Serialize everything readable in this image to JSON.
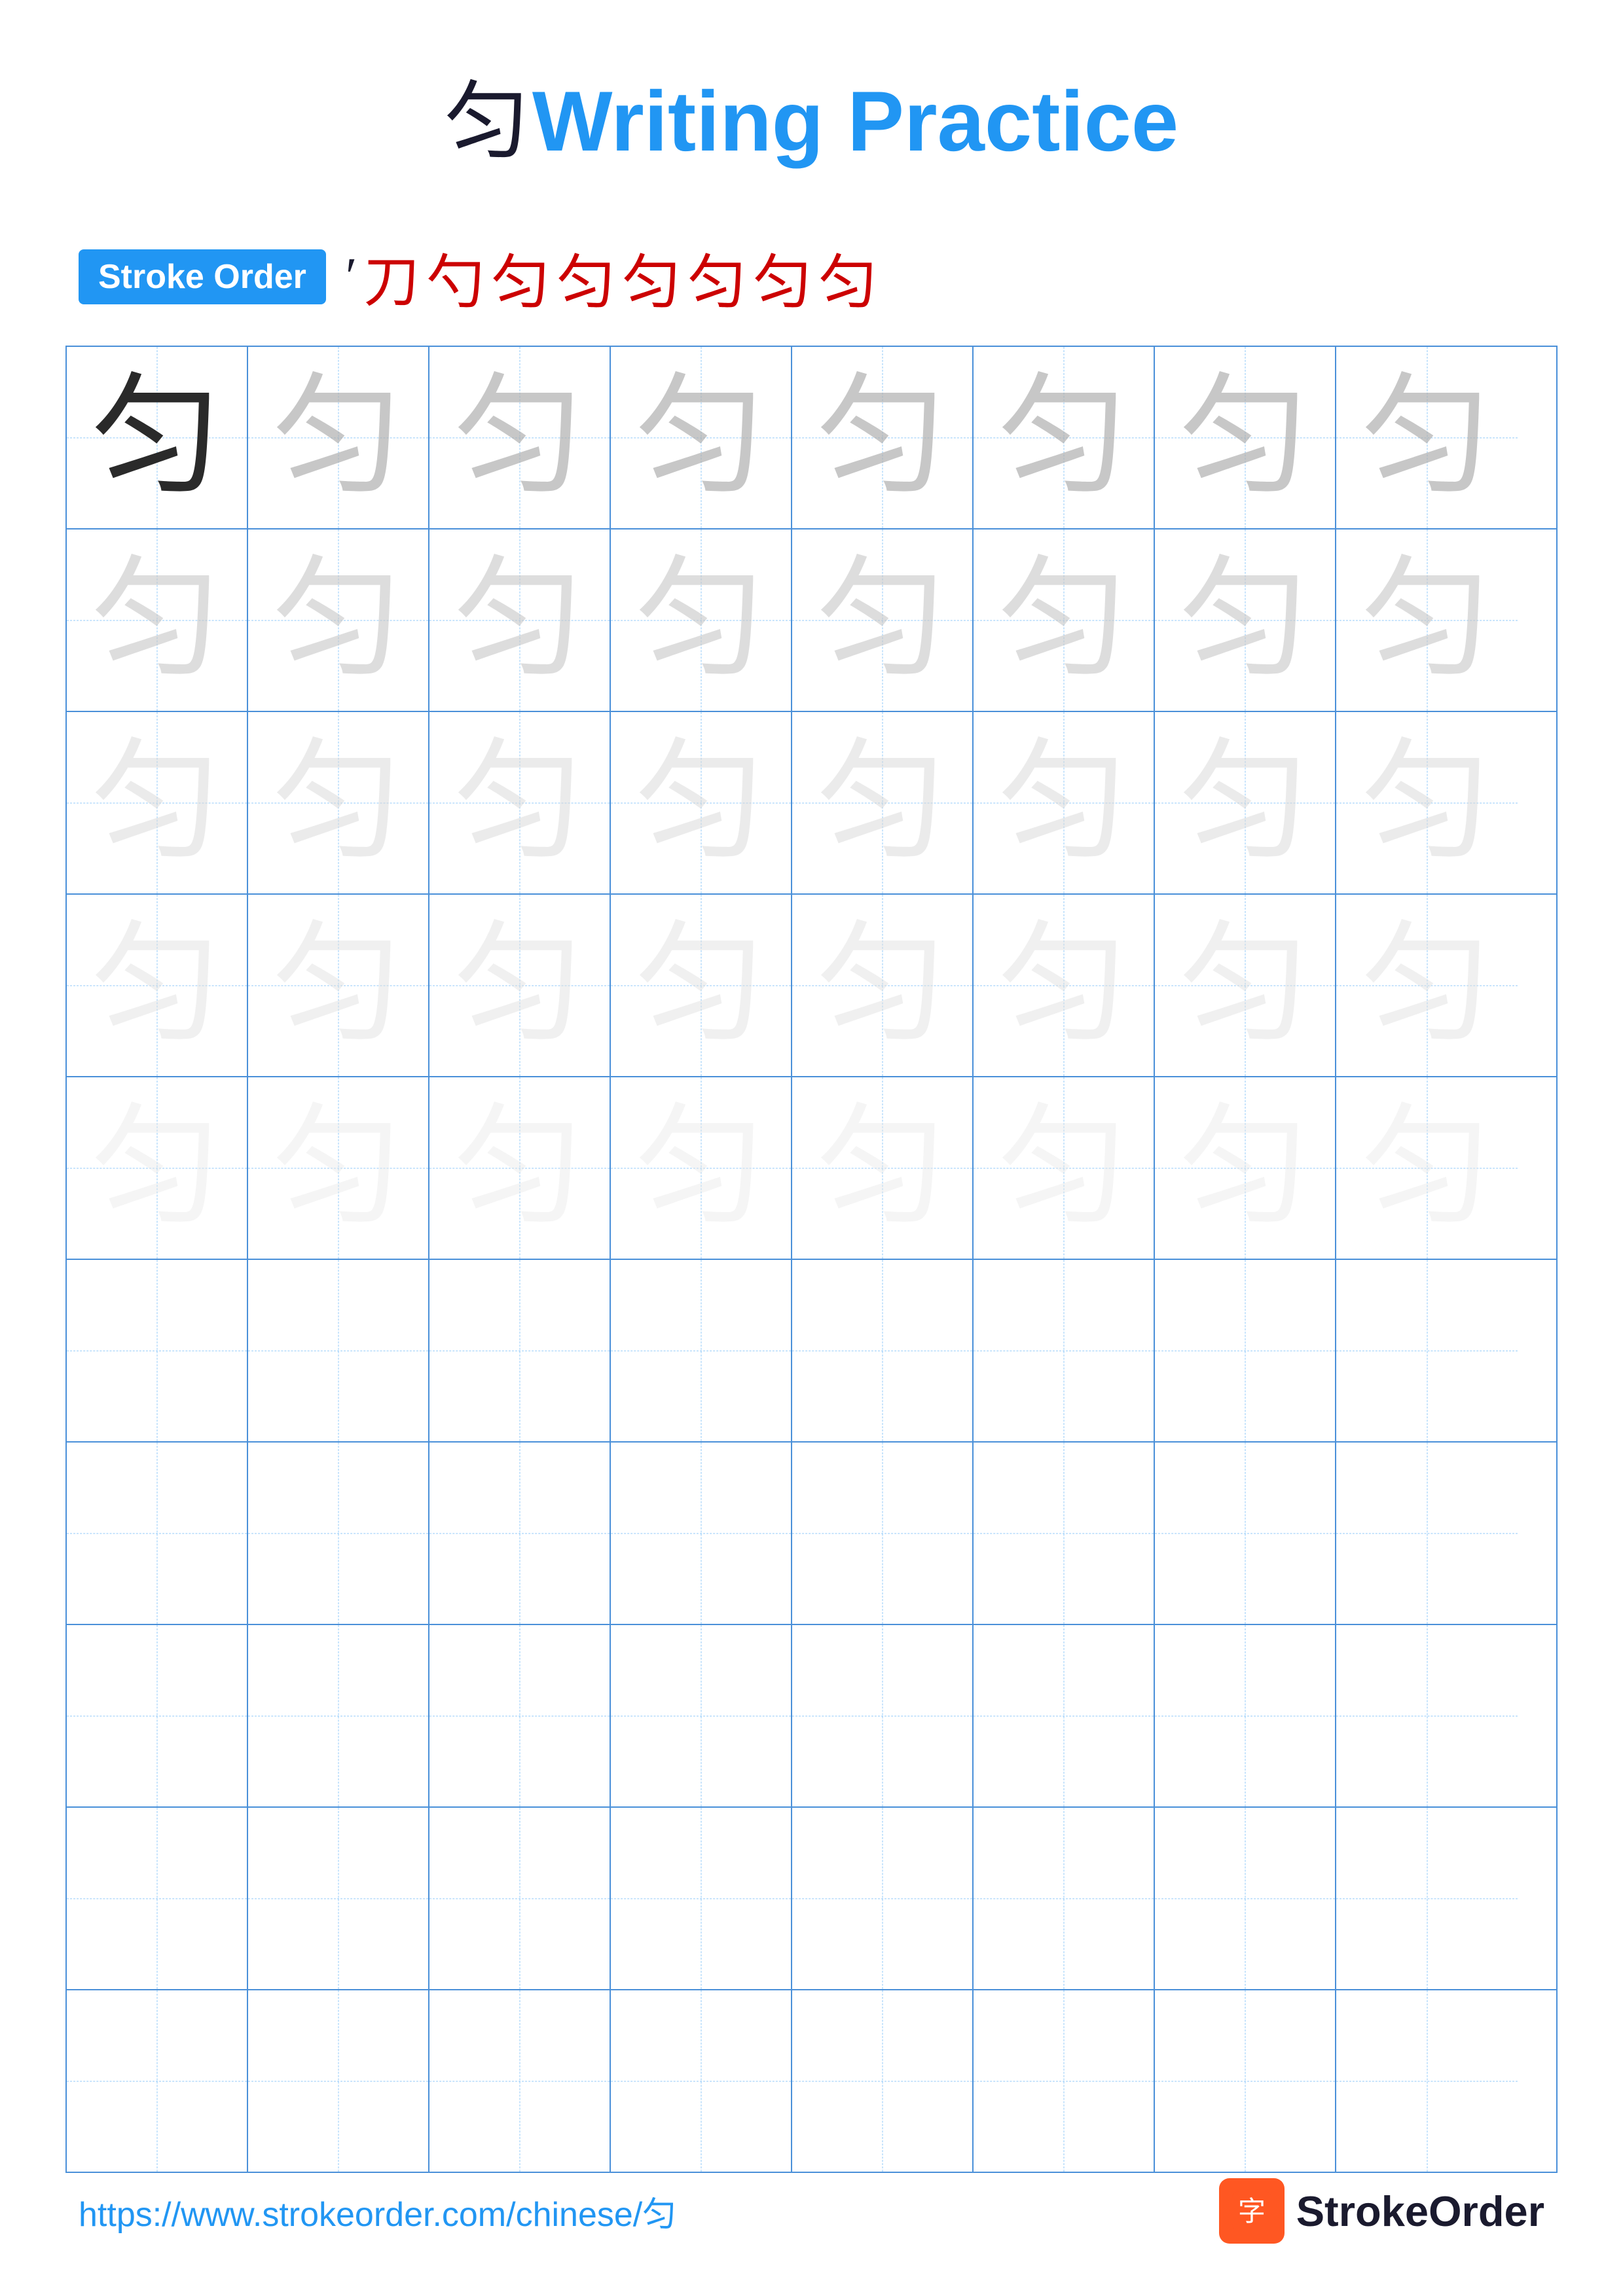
{
  "title": {
    "char": "匀",
    "label": "Writing Practice",
    "url": "https://www.strokeorder.com/chinese/匀",
    "logo_text": "StrokeOrder"
  },
  "stroke_order": {
    "badge": "Stroke Order",
    "strokes": [
      "'",
      "刀",
      "勺",
      "匀",
      "匀",
      "匀",
      "匀",
      "匀",
      "匀"
    ]
  },
  "grid": {
    "char": "匀",
    "rows": 10,
    "cols": 8
  }
}
